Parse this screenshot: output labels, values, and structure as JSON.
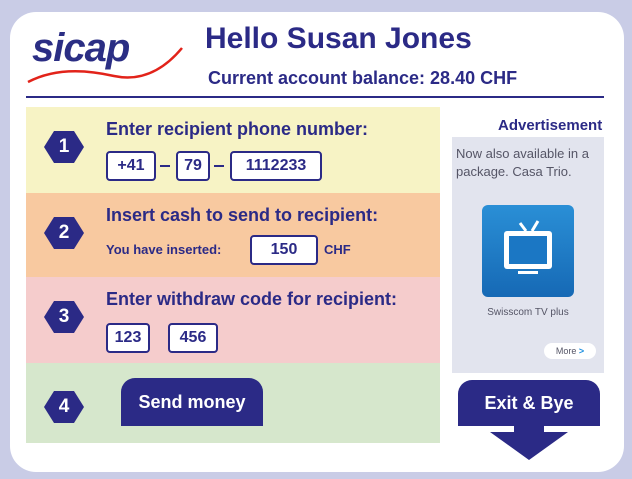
{
  "brand": {
    "logo_text": "sicap"
  },
  "header": {
    "greeting": "Hello Susan Jones",
    "balance": "Current account balance: 28.40 CHF"
  },
  "steps": [
    {
      "number": "1",
      "title": "Enter recipient phone number:",
      "fields": [
        "+41",
        "79",
        "1112233"
      ]
    },
    {
      "number": "2",
      "title": "Insert cash to send to recipient:",
      "inserted_label": "You have inserted:",
      "inserted_value": "150",
      "currency": "CHF"
    },
    {
      "number": "3",
      "title": "Enter withdraw code for recipient:",
      "fields": [
        "123",
        "456"
      ]
    },
    {
      "number": "4",
      "button": "Send money"
    }
  ],
  "ad": {
    "title": "Advertisement",
    "text": "Now also available in a package. Casa Trio.",
    "caption": "Swisscom TV plus",
    "more": "More",
    "more_arrow": ">"
  },
  "exit_button": "Exit & Bye",
  "colors": {
    "navy": "#2b2a86",
    "step1_bg": "#f7f3c5",
    "step2_bg": "#f8c9a0",
    "step3_bg": "#f5cccc",
    "step4_bg": "#d6e7cc",
    "logo_swoosh": "#e2231a"
  }
}
